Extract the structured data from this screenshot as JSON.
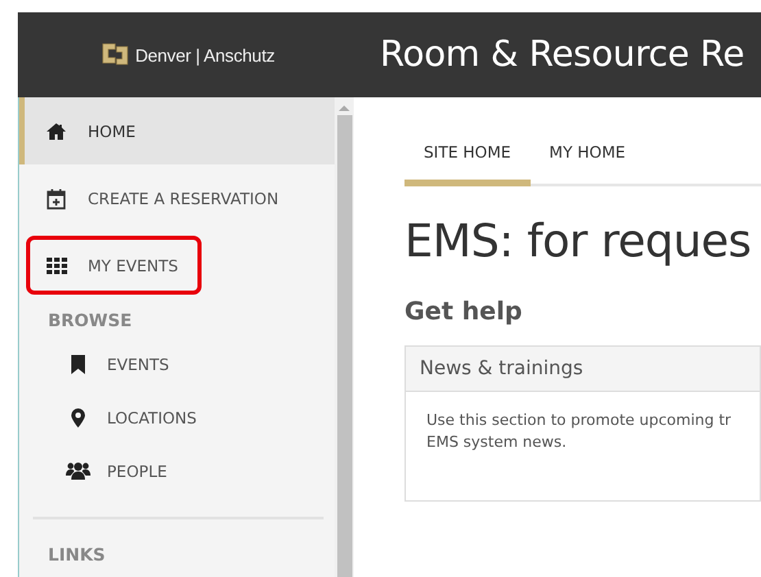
{
  "header": {
    "logo_text": "Denver | Anschutz",
    "title": "Room & Resource Re"
  },
  "sidebar": {
    "items": [
      {
        "kind": "link",
        "label": "HOME",
        "selected": true,
        "highlighted": false
      },
      {
        "kind": "link",
        "label": "CREATE A RESERVATION",
        "selected": false,
        "highlighted": false
      },
      {
        "kind": "link",
        "label": "MY EVENTS",
        "selected": false,
        "highlighted": true
      },
      {
        "kind": "section",
        "label": "BROWSE"
      },
      {
        "kind": "sublink",
        "label": "EVENTS",
        "selected": false,
        "highlighted": false
      },
      {
        "kind": "sublink",
        "label": "LOCATIONS",
        "selected": false,
        "highlighted": false
      },
      {
        "kind": "sublink",
        "label": "PEOPLE",
        "selected": false,
        "highlighted": false
      },
      {
        "kind": "divider"
      },
      {
        "kind": "section",
        "label": "LINKS"
      }
    ]
  },
  "tabs": [
    {
      "label": "SITE HOME",
      "selected": true
    },
    {
      "label": "MY HOME",
      "selected": false
    }
  ],
  "page_title": "EMS: for reques",
  "section_heading": "Get help",
  "panel": {
    "title": "News & trainings",
    "body": "Use this section to promote upcoming tr\nEMS system news."
  }
}
